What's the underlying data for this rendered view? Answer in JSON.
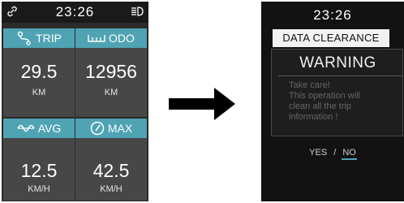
{
  "left_screen": {
    "clock": "23:26",
    "status_icons": [
      "link-icon",
      "headlight-icon"
    ],
    "cells": [
      {
        "label": "TRIP",
        "icon": "trip-route-icon",
        "value": "29.5",
        "unit": "KM"
      },
      {
        "label": "ODO",
        "icon": "odometer-icon",
        "value": "12956",
        "unit": "KM"
      },
      {
        "label": "AVG",
        "icon": "average-speed-icon",
        "value": "12.5",
        "unit": "KM/H"
      },
      {
        "label": "MAX",
        "icon": "max-speed-gauge-icon",
        "value": "42.5",
        "unit": "KM/H"
      }
    ]
  },
  "arrow": {
    "icon": "right-arrow-icon"
  },
  "right_screen": {
    "clock": "23:26",
    "title": "DATA CLEARANCE",
    "warning_title": "WARNING",
    "warning_lines": [
      "Take care!",
      "This operation will",
      "clean all the trip",
      "information !"
    ],
    "yes_label": "YES",
    "separator": "/",
    "no_label": "NO",
    "selected": "NO"
  },
  "colors": {
    "accent": "#4fa3b3",
    "left_background": "#2b2b2b",
    "cell_background": "#474747",
    "right_background": "#121212"
  }
}
